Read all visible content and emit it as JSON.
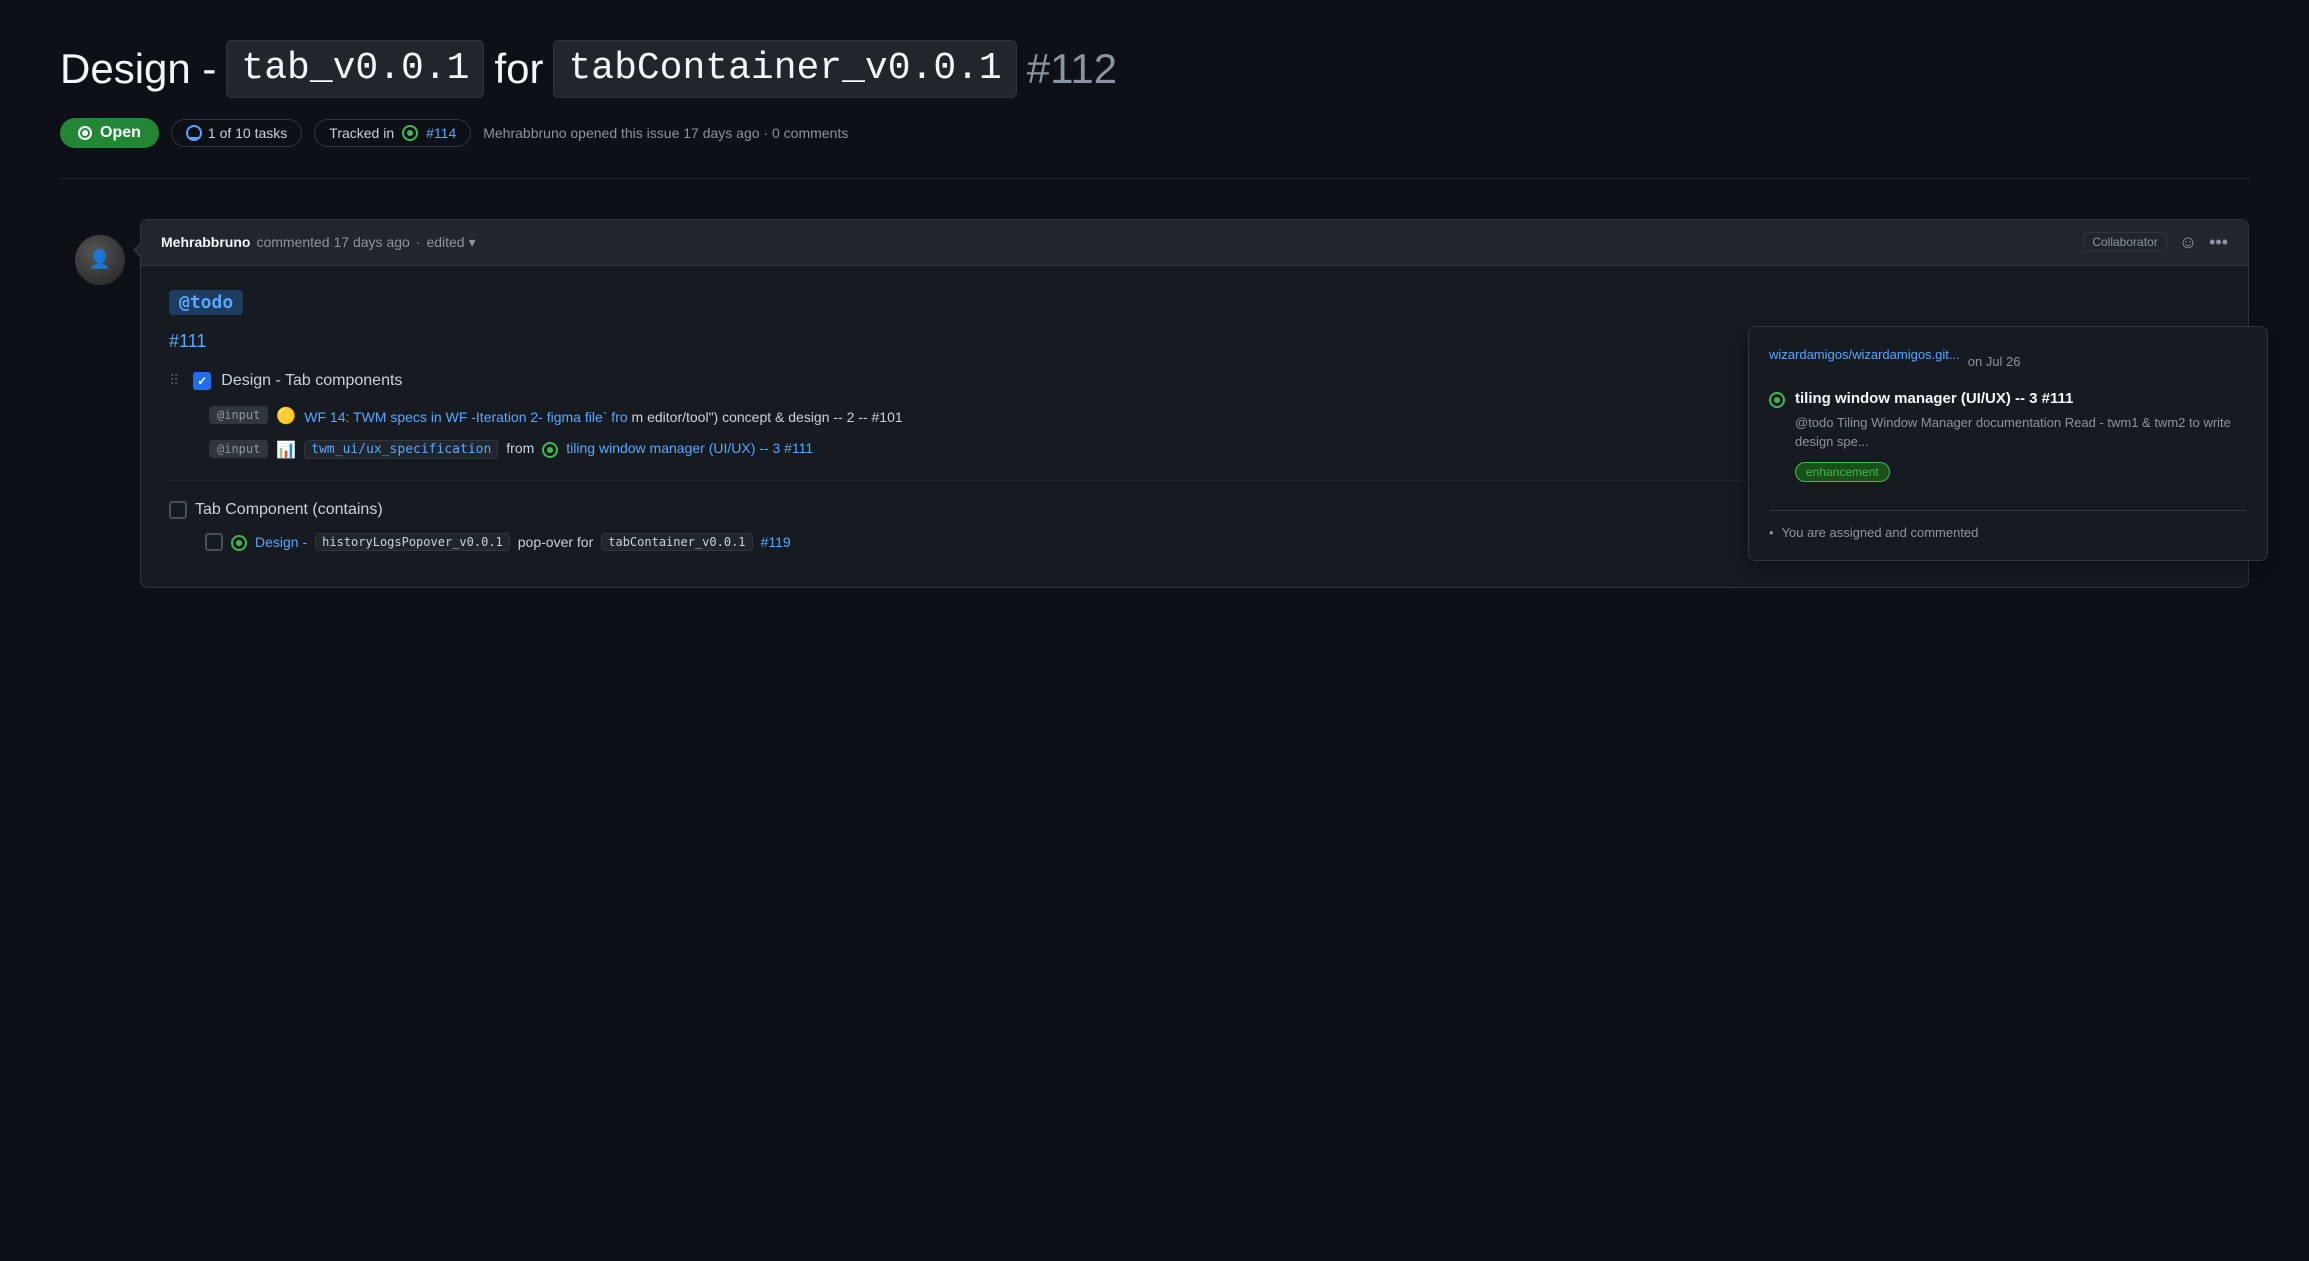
{
  "page": {
    "title": {
      "prefix": "Design - ",
      "code1": "tab_v0.0.1",
      "middle": " for ",
      "code2": "tabContainer_v0.0.1",
      "number": "#112"
    },
    "status": {
      "open_label": "Open",
      "tasks_label": "1 of 10 tasks",
      "tracked_label": "Tracked in",
      "tracked_number": "#114",
      "meta": "Mehrabbruno opened this issue 17 days ago · 0 comments"
    },
    "comment": {
      "username": "Mehrabbruno",
      "action": "commented 17 days ago",
      "edited": "edited",
      "collaborator": "Collaborator",
      "todo_tag": "@todo",
      "issue_ref": "#111",
      "checklist": [
        {
          "checked": true,
          "label": "Design - Tab components"
        }
      ],
      "sub_items": [
        {
          "badge": "@input",
          "emoji": "🟡",
          "text": "WF 14: TWM specs in WF -Iteration 2- figma file` from editor/tool\") concept & design -- 2 -- #101"
        },
        {
          "badge": "@input",
          "emoji": "📊",
          "link": "twm_ui/ux_specification",
          "text_after": "from",
          "has_green_dot": true,
          "link2": "tiling window manager (UI/UX) -- 3 #111"
        }
      ],
      "tab_component_section": {
        "label": "Tab Component (contains)",
        "items": [
          {
            "checked": false,
            "has_green_dot": true,
            "prefix": "Design - ",
            "code1": "historyLogsPopover_v0.0.1",
            "middle": " pop-over for ",
            "code2": "tabContainer_v0.0.1",
            "number": "#119"
          }
        ]
      }
    },
    "popover": {
      "repo": "wizardamigos/wizardamigos.git...",
      "date": "on Jul 26",
      "issue_title": "tiling window manager (UI/UX) -- 3 #111",
      "issue_body": "@todo Tiling Window Manager documentation Read - twm1 & twm2 to write design spe...",
      "label": "enhancement",
      "assigned_text": "You are assigned and commented"
    }
  }
}
